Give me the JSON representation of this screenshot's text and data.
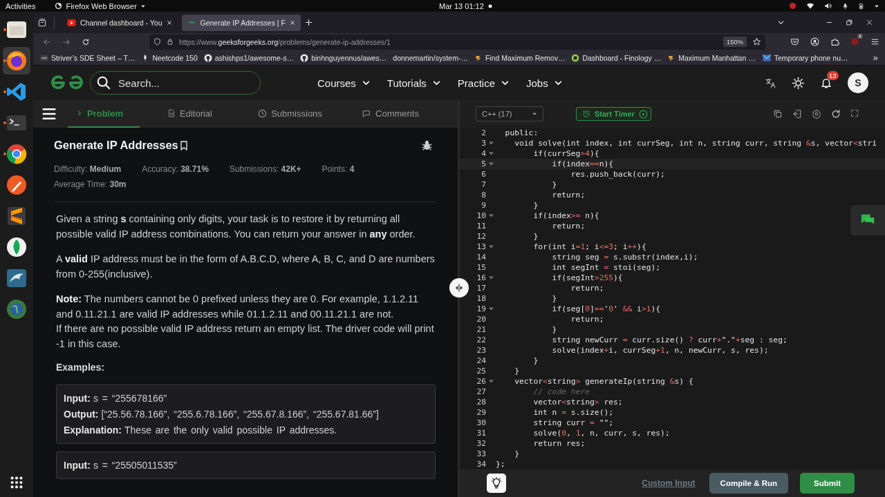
{
  "system_bar": {
    "activities": "Activities",
    "app_menu": "Firefox Web Browser",
    "clock": "Mar 13  01:12"
  },
  "dock": {
    "apps": [
      {
        "kind": "folder",
        "running": true,
        "selected": false
      },
      {
        "kind": "firefox",
        "running": true,
        "selected": true
      },
      {
        "kind": "vscode",
        "running": true,
        "selected": false
      },
      {
        "kind": "terminal",
        "running": true,
        "selected": false
      },
      {
        "kind": "chrome",
        "running": true,
        "selected": false
      },
      {
        "kind": "postman",
        "running": false,
        "selected": false
      },
      {
        "kind": "sublime",
        "running": false,
        "selected": false
      },
      {
        "kind": "leaf",
        "running": false,
        "selected": false
      },
      {
        "kind": "dolphin",
        "running": false,
        "selected": false
      },
      {
        "kind": "globe",
        "running": false,
        "selected": false
      }
    ]
  },
  "browser": {
    "tabs": [
      {
        "title": "Channel dashboard - You",
        "kind": "video",
        "selected": false
      },
      {
        "title": "Generate IP Addresses | F",
        "kind": "site",
        "selected": true
      }
    ],
    "url": {
      "prefix": "https://www.",
      "domain": "geeksforgeeks.org",
      "path": "/problems/generate-ip-addresses/1"
    },
    "zoom": "150%",
    "addon_badge": "4",
    "bookmarks": [
      {
        "label": "Striver’s SDE Sheet – T…",
        "kind": "dark"
      },
      {
        "label": "Neetcode 150",
        "kind": "rocket"
      },
      {
        "label": "ashishps1/awesome-s…",
        "kind": "github"
      },
      {
        "label": "binhnguyennus/awes…",
        "kind": "github"
      },
      {
        "label": "donnemartin/system-…",
        "kind": "none"
      },
      {
        "label": "Find Maximum Remov…",
        "kind": "arrow"
      },
      {
        "label": "Dashboard - Finology …",
        "kind": "ring"
      },
      {
        "label": "Maximum Manhattan …",
        "kind": "arrow"
      },
      {
        "label": "Temporary phone nu…",
        "kind": "mail"
      }
    ],
    "overflow": "»"
  },
  "site": {
    "search": {
      "placeholder": "Search..."
    },
    "nav": [
      "Courses",
      "Tutorials",
      "Practice",
      "Jobs"
    ],
    "notifications": "13",
    "avatar": "S"
  },
  "problem": {
    "tabs": [
      {
        "label": "Problem",
        "kind": "problem",
        "selected": true
      },
      {
        "label": "Editorial",
        "kind": "editorial",
        "selected": false
      },
      {
        "label": "Submissions",
        "kind": "submissions",
        "selected": false
      },
      {
        "label": "Comments",
        "kind": "comments",
        "selected": false
      }
    ],
    "title": "Generate IP Addresses",
    "meta_rows": [
      [
        "Difficulty: **Medium**",
        "Accuracy: **38.71%**",
        "Submissions: **42K+**",
        "Points: **4**"
      ],
      [
        "Average Time: **30m**"
      ]
    ],
    "paragraphs": [
      "Given a string **s** containing only digits, your task is to restore it by returning all possible valid IP address combinations. You can return your answer in **any** order.",
      "A **valid** IP address must be in the form of A.B.C.D, where A, B, C, and D are numbers from 0-255(inclusive).",
      "**Note:** The numbers cannot be 0 prefixed unless they are 0. For example, 1.1.2.11 and 0.11.21.1 are valid IP addresses while 01.1.2.11 and 00.11.21.1 are not.\nIf there are no possible valid IP address return an empty list. The driver code will print -1 in this case."
    ],
    "examples_heading": "Examples:",
    "examples": [
      {
        "rows": [
          {
            "label": "Input:",
            "value": "s = “255678166”"
          },
          {
            "label": "Output:",
            "value": "[“25.56.78.166”, “255.6.78.166”, “255.67.8.166”, “255.67.81.66”]"
          },
          {
            "label": "Explanation:",
            "value": "These are the only valid possible IP addresses."
          }
        ]
      },
      {
        "rows": [
          {
            "label": "Input:",
            "value": "s = “25505011535”"
          }
        ]
      }
    ]
  },
  "editor": {
    "language": "C++ (17)",
    "timer": "Start Timer",
    "lines": [
      {
        "number": "2",
        "text": "  public:",
        "kind": "code",
        "fold": false,
        "active": false
      },
      {
        "number": "3",
        "text": "    void solve(int index, int currSeg, int n, string curr, string &s, vector<stri",
        "kind": "code",
        "fold": true,
        "active": false
      },
      {
        "number": "4",
        "text": "        if(currSeg>4){",
        "kind": "code",
        "fold": true,
        "active": false
      },
      {
        "number": "5",
        "text": "            if(index==n){",
        "kind": "code",
        "fold": true,
        "active": true
      },
      {
        "number": "6",
        "text": "                res.push_back(curr);",
        "kind": "code",
        "fold": false,
        "active": false
      },
      {
        "number": "7",
        "text": "            }",
        "kind": "code",
        "fold": false,
        "active": false
      },
      {
        "number": "8",
        "text": "            return;",
        "kind": "code",
        "fold": false,
        "active": false
      },
      {
        "number": "9",
        "text": "        }",
        "kind": "code",
        "fold": false,
        "active": false
      },
      {
        "number": "10",
        "text": "        if(index>= n){",
        "kind": "code",
        "fold": true,
        "active": false
      },
      {
        "number": "11",
        "text": "            return;",
        "kind": "code",
        "fold": false,
        "active": false
      },
      {
        "number": "12",
        "text": "        }",
        "kind": "code",
        "fold": false,
        "active": false
      },
      {
        "number": "13",
        "text": "        for(int i=1; i<=3; i++){",
        "kind": "code",
        "fold": true,
        "active": false
      },
      {
        "number": "14",
        "text": "            string seg = s.substr(index,i);",
        "kind": "code",
        "fold": false,
        "active": false
      },
      {
        "number": "15",
        "text": "            int segInt = stoi(seg);",
        "kind": "code",
        "fold": false,
        "active": false
      },
      {
        "number": "16",
        "text": "            if(segInt>255){",
        "kind": "code",
        "fold": true,
        "active": false
      },
      {
        "number": "17",
        "text": "                return;",
        "kind": "code",
        "fold": false,
        "active": false
      },
      {
        "number": "18",
        "text": "            }",
        "kind": "code",
        "fold": false,
        "active": false
      },
      {
        "number": "19",
        "text": "            if(seg[0]=='0' && i>1){",
        "kind": "code",
        "fold": true,
        "active": false
      },
      {
        "number": "20",
        "text": "                return;",
        "kind": "code",
        "fold": false,
        "active": false
      },
      {
        "number": "21",
        "text": "            }",
        "kind": "code",
        "fold": false,
        "active": false
      },
      {
        "number": "22",
        "text": "            string newCurr = curr.size() ? curr+\".\"+seg : seg;",
        "kind": "code",
        "fold": false,
        "active": false
      },
      {
        "number": "23",
        "text": "            solve(index+i, currSeg+1, n, newCurr, s, res);",
        "kind": "code",
        "fold": false,
        "active": false
      },
      {
        "number": "24",
        "text": "        }",
        "kind": "code",
        "fold": false,
        "active": false
      },
      {
        "number": "25",
        "text": "    }",
        "kind": "code",
        "fold": false,
        "active": false
      },
      {
        "number": "26",
        "text": "    vector<string> generateIp(string &s) {",
        "kind": "code",
        "fold": true,
        "active": false
      },
      {
        "number": "27",
        "text": "        // code here",
        "kind": "comment",
        "fold": false,
        "active": false
      },
      {
        "number": "28",
        "text": "        vector<string> res;",
        "kind": "code",
        "fold": false,
        "active": false
      },
      {
        "number": "29",
        "text": "        int n = s.size();",
        "kind": "code",
        "fold": false,
        "active": false
      },
      {
        "number": "30",
        "text": "        string curr = \"\";",
        "kind": "code",
        "fold": false,
        "active": false
      },
      {
        "number": "31",
        "text": "        solve(0, 1, n, curr, s, res);",
        "kind": "code",
        "fold": false,
        "active": false
      },
      {
        "number": "32",
        "text": "        return res;",
        "kind": "code",
        "fold": false,
        "active": false
      },
      {
        "number": "33",
        "text": "    }",
        "kind": "code",
        "fold": false,
        "active": false
      },
      {
        "number": "34",
        "text": "};",
        "kind": "code",
        "fold": false,
        "active": false
      }
    ],
    "custom_input": "Custom Input",
    "run": "Compile & Run",
    "submit": "Submit"
  }
}
